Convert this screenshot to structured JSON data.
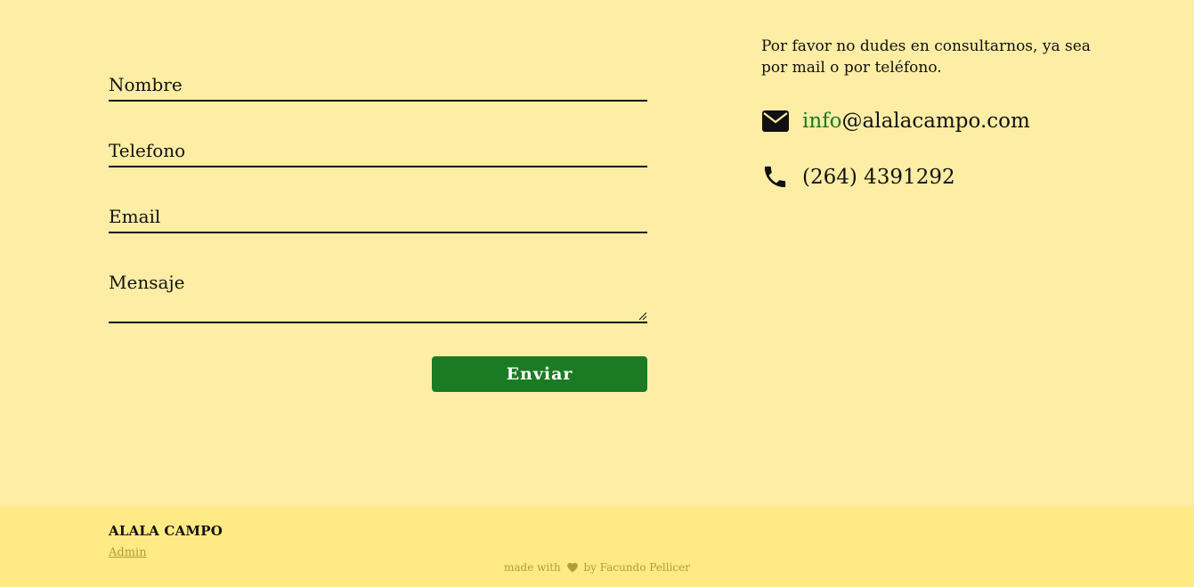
{
  "form": {
    "fields": [
      {
        "label": "Nombre"
      },
      {
        "label": "Telefono"
      },
      {
        "label": "Email"
      },
      {
        "label": "Mensaje"
      }
    ],
    "submit_label": "Enviar"
  },
  "contact": {
    "intro": "Por favor no dudes en consultarnos, ya sea por mail o por teléfono.",
    "email_user": "info",
    "email_domain": "@alalacampo.com",
    "phone": "(264) 4391292",
    "icons": [
      "envelope-icon",
      "phone-icon"
    ]
  },
  "footer": {
    "brand": "ALALA CAMPO",
    "admin_label": "Admin",
    "credit_prefix": "made with",
    "credit_suffix": "by Facundo Pellicer",
    "icons": [
      "heart-icon"
    ]
  },
  "colors": {
    "background": "#FEEDA5",
    "footer_background": "#FFEA85",
    "accent_green": "#1B7A24",
    "footer_text": "#B59A3A",
    "text": "#111111"
  }
}
